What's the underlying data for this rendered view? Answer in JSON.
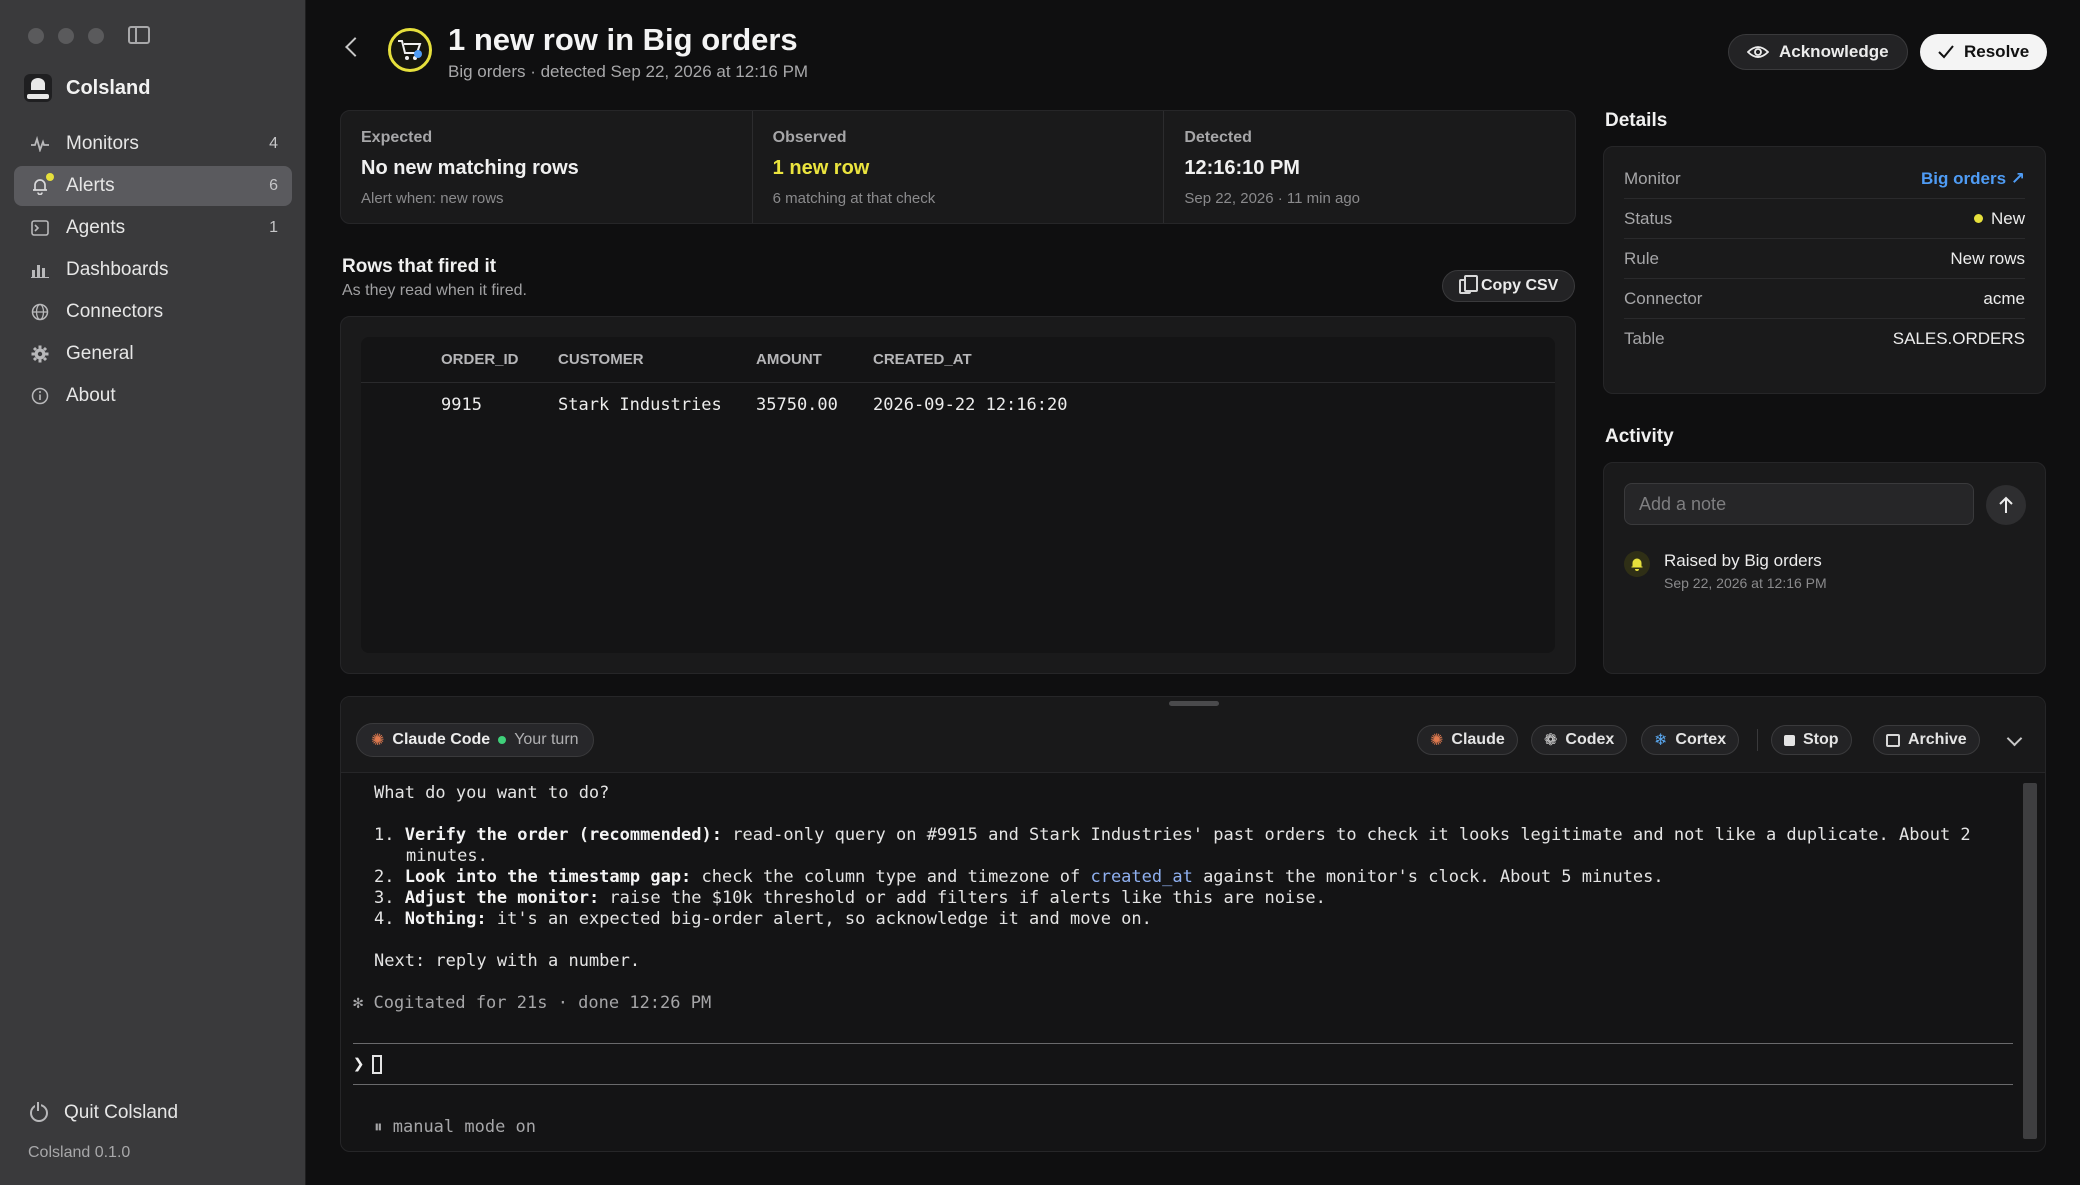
{
  "app": {
    "name": "Colsland",
    "version": "Colsland 0.1.0",
    "quit_label": "Quit Colsland"
  },
  "sidebar": {
    "items": [
      {
        "label": "Monitors",
        "count": "4",
        "icon": "pulse-icon"
      },
      {
        "label": "Alerts",
        "count": "6",
        "icon": "bell-icon"
      },
      {
        "label": "Agents",
        "count": "1",
        "icon": "terminal-icon"
      },
      {
        "label": "Dashboards",
        "count": "",
        "icon": "bar-chart-icon"
      },
      {
        "label": "Connectors",
        "count": "",
        "icon": "globe-icon"
      },
      {
        "label": "General",
        "count": "",
        "icon": "gear-icon"
      },
      {
        "label": "About",
        "count": "",
        "icon": "info-icon"
      }
    ]
  },
  "header": {
    "title": "1 new row in Big orders",
    "subtitle": "Big orders · detected Sep 22, 2026 at 12:16 PM",
    "acknowledge_label": "Acknowledge",
    "resolve_label": "Resolve"
  },
  "stats": [
    {
      "label": "Expected",
      "value": "No new matching rows",
      "sub": "Alert when: new rows"
    },
    {
      "label": "Observed",
      "value": "1 new row",
      "sub": "6 matching at that check"
    },
    {
      "label": "Detected",
      "value": "12:16:10 PM",
      "sub": "Sep 22, 2026 · 11 min ago"
    }
  ],
  "rows": {
    "title": "Rows that fired it",
    "subtitle": "As they read when it fired.",
    "copy_label": "Copy CSV",
    "columns": [
      "ORDER_ID",
      "CUSTOMER",
      "AMOUNT",
      "CREATED_AT"
    ],
    "data": [
      [
        "9915",
        "Stark Industries",
        "35750.00",
        "2026-09-22 12:16:20"
      ]
    ]
  },
  "details": {
    "title": "Details",
    "monitor_key": "Monitor",
    "monitor_val": "Big orders ↗",
    "status_key": "Status",
    "status_val": "New",
    "rule_key": "Rule",
    "rule_val": "New rows",
    "connector_key": "Connector",
    "connector_val": "acme",
    "table_key": "Table",
    "table_val": "SALES.ORDERS"
  },
  "activity": {
    "title": "Activity",
    "note_placeholder": "Add a note",
    "item_text": "Raised by Big orders",
    "item_time": "Sep 22, 2026 at 12:16 PM"
  },
  "terminal": {
    "session_name": "Claude Code",
    "session_state": "Your turn",
    "btn_claude": "Claude",
    "btn_codex": "Codex",
    "btn_cortex": "Cortex",
    "btn_stop": "Stop",
    "btn_archive": "Archive",
    "question": "What do you want to do?",
    "opt1_num": "1. ",
    "opt1_bold": "Verify the order (recommended):",
    "opt1_text": " read-only query on #9915 and Stark Industries' past orders to check it looks legitimate and not like a duplicate. About 2",
    "opt1_cont": "minutes.",
    "opt2_num": "2. ",
    "opt2_bold": "Look into the timestamp gap:",
    "opt2_text_a": " check the column type and timezone of ",
    "opt2_code": "created_at",
    "opt2_text_b": " against the monitor's clock. About 5 minutes.",
    "opt3_num": "3. ",
    "opt3_bold": "Adjust the monitor:",
    "opt3_text": " raise the $10k threshold or add filters if alerts like this are noise.",
    "opt4_num": "4. ",
    "opt4_bold": "Nothing:",
    "opt4_text": " it's an expected big-order alert, so acknowledge it and move on.",
    "next": "Next: reply with a number.",
    "cogitated": "✻ Cogitated for 21s · done 12:26 PM",
    "prompt_symbol": "❯",
    "mode": "⏸ manual mode on"
  }
}
